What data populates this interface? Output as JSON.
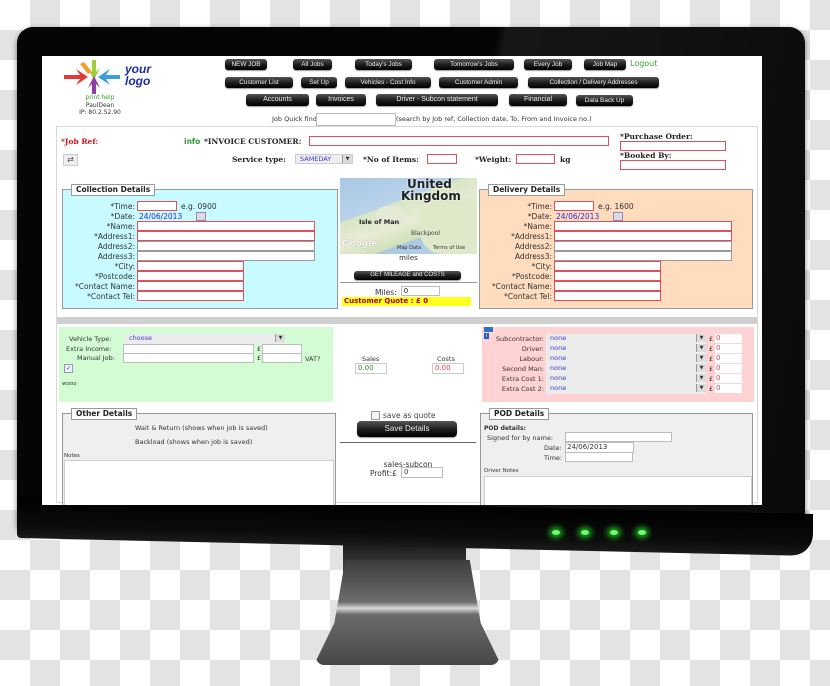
{
  "header": {
    "logo_text_line1": "your",
    "logo_text_line2": "logo",
    "print_help": "print help",
    "username": "PaulDean",
    "ip": "IP: 80.2.52.90",
    "logout": "Logout",
    "nav_row1": [
      "NEW JOB",
      "All Jobs",
      "Today's Jobs",
      "Tomorrow's Jobs",
      "Every Job",
      "Job Map"
    ],
    "nav_row2": [
      "Customer List",
      "Set Up",
      "Vehicles - Cost Info",
      "Customer Admin",
      "Collection / Delivery Addresses"
    ],
    "nav_row3": [
      "Accounts",
      "Invoices",
      "Driver - Subcon statement",
      "Financial",
      "Data Back Up"
    ],
    "quick_finder_label": "Job Quick finder",
    "quick_finder_value": "",
    "quick_finder_hint": "(search by Job ref, Collection date, To, From and Invoice no.)"
  },
  "job": {
    "job_ref_label": "*Job Ref:",
    "info_link": "info",
    "invoice_customer_label": "*INVOICE CUSTOMER:",
    "invoice_customer_value": "",
    "service_type_label": "Service type:",
    "service_type_value": "SAMEDAY",
    "items_label": "*No of Items:",
    "items_value": "",
    "weight_label": "*Weight:",
    "weight_value": "",
    "weight_unit": "kg",
    "purchase_order_label": "*Purchase Order:",
    "purchase_order_value": "",
    "booked_by_label": "*Booked By:",
    "booked_by_value": ""
  },
  "collection": {
    "title": "Collection Details",
    "time_label": "*Time:",
    "time_value": "",
    "time_hint": "e.g. 0900",
    "date_label": "*Date:",
    "date_value": "24/06/2013",
    "name_label": "*Name:",
    "address1_label": "*Address1:",
    "address2_label": "Address2:",
    "address3_label": "Address3:",
    "city_label": "*City:",
    "postcode_label": "*Postcode:",
    "contact_name_label": "*Contact Name:",
    "contact_tel_label": "*Contact Tel:"
  },
  "delivery": {
    "title": "Delivery Details",
    "time_label": "*Time:",
    "time_value": "",
    "time_hint": "e.g. 1600",
    "date_label": "*Date:",
    "date_value": "24/06/2013",
    "name_label": "*Name:",
    "address1_label": "*Address1:",
    "address2_label": "Address2:",
    "address3_label": "Address3:",
    "city_label": "*City:",
    "postcode_label": "*Postcode:",
    "contact_name_label": "*Contact Name:",
    "contact_tel_label": "*Contact Tel:"
  },
  "map": {
    "country_label_1": "United",
    "country_label_2": "Kingdom",
    "place_isle_of_man": "Isle of Man",
    "place_blackpool": "Blackpool",
    "google_logo": "Google",
    "map_data": "Map Data",
    "terms": "Terms of Use",
    "miles_caption": "miles",
    "get_mileage_button": "GET MILEAGE and COSTS",
    "miles_label": "Miles:",
    "miles_value": "0",
    "quote_text": "Customer Quote : £ 0"
  },
  "vehicle": {
    "vehicle_type_label": "Vehicle Type:",
    "vehicle_type_value": "choose",
    "extra_income_label": "Extra Income:",
    "manual_job_label": "Manual Job:",
    "currency": "£",
    "vat_label": "VAT?",
    "vat_checked": true,
    "wooo": "wooo"
  },
  "totals": {
    "sales_label": "Sales",
    "sales_value": "0.00",
    "costs_label": "Costs",
    "costs_value": "0.00"
  },
  "costs": {
    "rows": [
      {
        "label": "Subcontractor:",
        "value": "none",
        "amount": "0"
      },
      {
        "label": "Driver:",
        "value": "none",
        "amount": "0"
      },
      {
        "label": "Labour:",
        "value": "none",
        "amount": "0"
      },
      {
        "label": "Second Man:",
        "value": "none",
        "amount": "0"
      },
      {
        "label": "Extra Cost 1:",
        "value": "none",
        "amount": "0"
      },
      {
        "label": "Extra Cost 2:",
        "value": "none",
        "amount": "0"
      }
    ],
    "currency": "£"
  },
  "other": {
    "title": "Other Details",
    "wait_return": "Wait & Return (shows when job is saved)",
    "backload": "Backload (shows when job is saved)",
    "notes_label": "Notes",
    "notes_value": ""
  },
  "save": {
    "save_as_quote_label": "save as quote",
    "save_as_quote_checked": false,
    "save_button": "Save Details",
    "sales_subcon": "sales-subcon",
    "profit_label": "Profit:£",
    "profit_value": "0"
  },
  "pod": {
    "title": "POD Details",
    "subtitle": "POD details:",
    "signed_label": "Signed for by name:",
    "signed_value": "",
    "date_label": "Date:",
    "date_value": "24/06/2013",
    "time_label": "Time:",
    "time_value": "",
    "driver_notes_label": "Driver Notes",
    "driver_notes_value": ""
  }
}
